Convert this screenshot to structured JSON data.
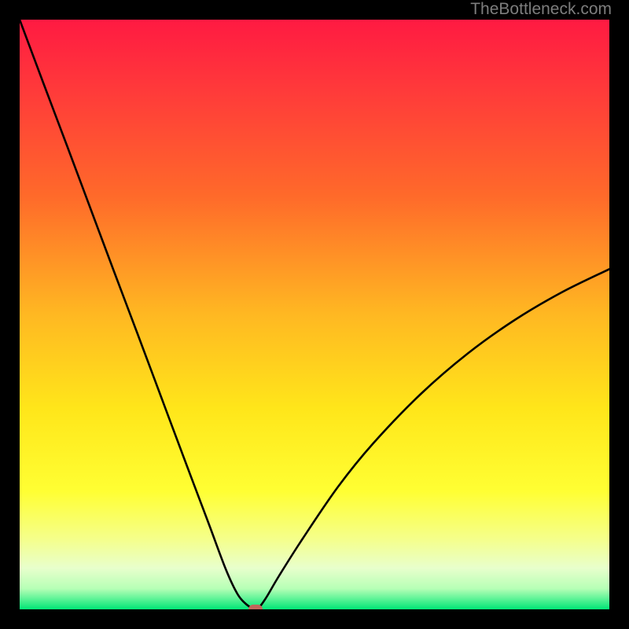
{
  "watermark": "TheBottleneck.com",
  "colors": {
    "frame": "#000000",
    "gradient_stops": [
      {
        "offset": 0.0,
        "color": "#ff1a42"
      },
      {
        "offset": 0.12,
        "color": "#ff3a3a"
      },
      {
        "offset": 0.3,
        "color": "#ff6a2a"
      },
      {
        "offset": 0.5,
        "color": "#ffb822"
      },
      {
        "offset": 0.66,
        "color": "#ffe61a"
      },
      {
        "offset": 0.8,
        "color": "#ffff33"
      },
      {
        "offset": 0.88,
        "color": "#f5ff8a"
      },
      {
        "offset": 0.93,
        "color": "#e8ffcc"
      },
      {
        "offset": 0.965,
        "color": "#b6ffb6"
      },
      {
        "offset": 1.0,
        "color": "#00e676"
      }
    ],
    "curve": "#000000",
    "marker": "#c1675b"
  },
  "chart_data": {
    "type": "line",
    "title": "",
    "xlabel": "",
    "ylabel": "",
    "xlim": [
      0,
      100
    ],
    "ylim": [
      0,
      100
    ],
    "series": [
      {
        "name": "bottleneck-curve",
        "x": [
          0,
          4,
          8,
          12,
          16,
          20,
          24,
          28,
          32,
          35,
          37,
          38.5,
          39.5,
          40,
          40.5,
          41,
          42,
          44,
          48,
          54,
          60,
          68,
          76,
          84,
          92,
          100
        ],
        "y": [
          100,
          89.3,
          78.7,
          68.0,
          57.3,
          46.7,
          36.0,
          25.3,
          14.7,
          6.7,
          2.5,
          0.8,
          0.2,
          0.0,
          0.2,
          0.8,
          2.3,
          5.7,
          12.0,
          20.8,
          28.2,
          36.5,
          43.4,
          49.1,
          53.8,
          57.7
        ]
      }
    ],
    "marker": {
      "x": 40,
      "y": 0
    },
    "annotations": [
      {
        "text": "TheBottleneck.com",
        "role": "watermark",
        "position": "top-right"
      }
    ]
  }
}
